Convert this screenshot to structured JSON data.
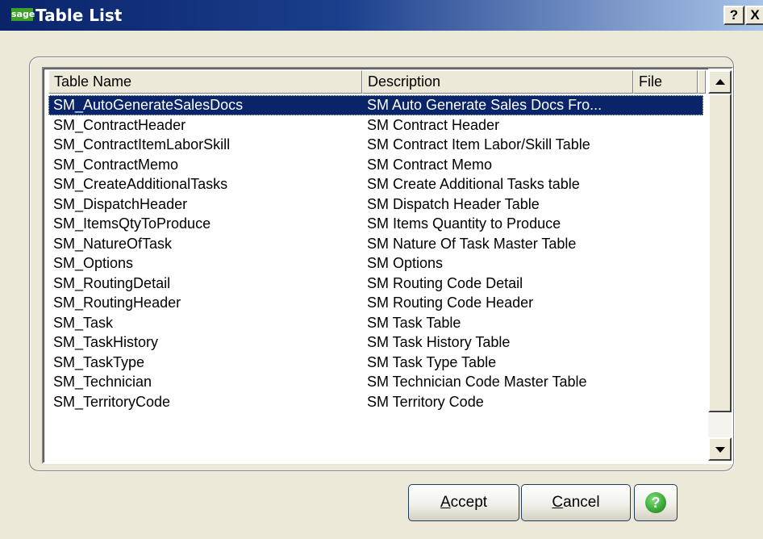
{
  "window": {
    "logo_text": "sage",
    "title": "Table List",
    "help_button": "?",
    "close_button": "X"
  },
  "list": {
    "columns": [
      "Table Name",
      "Description",
      "File"
    ],
    "selected_index": 0,
    "rows": [
      {
        "name": "SM_AutoGenerateSalesDocs",
        "description": "SM Auto Generate Sales Docs Fro..."
      },
      {
        "name": "SM_ContractHeader",
        "description": "SM Contract Header"
      },
      {
        "name": "SM_ContractItemLaborSkill",
        "description": "SM Contract Item Labor/Skill Table"
      },
      {
        "name": "SM_ContractMemo",
        "description": "SM Contract Memo"
      },
      {
        "name": "SM_CreateAdditionalTasks",
        "description": "SM Create Additional Tasks table"
      },
      {
        "name": "SM_DispatchHeader",
        "description": "SM Dispatch Header Table"
      },
      {
        "name": "SM_ItemsQtyToProduce",
        "description": "SM Items Quantity to Produce"
      },
      {
        "name": "SM_NatureOfTask",
        "description": "SM Nature Of Task Master Table"
      },
      {
        "name": "SM_Options",
        "description": "SM Options"
      },
      {
        "name": "SM_RoutingDetail",
        "description": "SM Routing Code Detail"
      },
      {
        "name": "SM_RoutingHeader",
        "description": "SM Routing Code Header"
      },
      {
        "name": "SM_Task",
        "description": "SM Task Table"
      },
      {
        "name": "SM_TaskHistory",
        "description": "SM Task History Table"
      },
      {
        "name": "SM_TaskType",
        "description": "SM Task Type Table"
      },
      {
        "name": "SM_Technician",
        "description": "SM Technician Code Master Table"
      },
      {
        "name": "SM_TerritoryCode",
        "description": "SM Territory Code"
      }
    ]
  },
  "buttons": {
    "accept_key": "A",
    "accept_rest": "ccept",
    "cancel_key": "C",
    "cancel_rest": "ancel",
    "help_glyph": "?"
  }
}
